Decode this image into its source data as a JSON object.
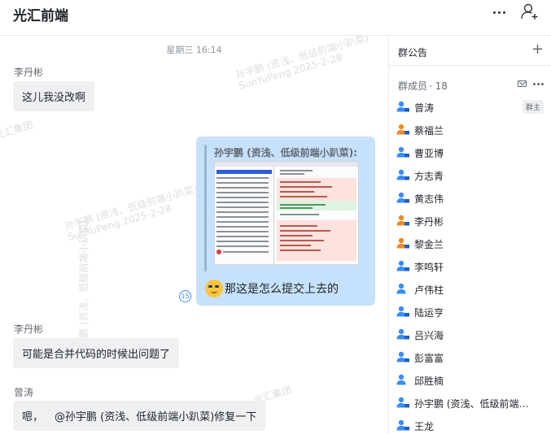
{
  "header": {
    "title": "光汇前端",
    "more_icon": "more-horizontal-icon",
    "add_member_icon": "user-add-icon"
  },
  "watermark": {
    "line1": "孙宇鹏 (资浅、低级前端小趴菜)",
    "line2": "SunYuPeng 2025-2-28",
    "company": "光汇集团"
  },
  "chat": {
    "timestamp": "星期三 16:14",
    "messages": [
      {
        "sender": "李丹彬",
        "text": "这儿我没改啊"
      },
      {
        "type": "reply-with-image",
        "quoted_author": "孙宇鹏 (资浅、低级前端小趴菜):",
        "reply_text": "那这是怎么提交上去的",
        "read_count": "15",
        "emoji_icon": "awkward-face-emoji-icon"
      },
      {
        "sender": "李丹彬",
        "text": "可能是合并代码的时候出问题了"
      },
      {
        "sender": "曾涛",
        "text_before": "嗯，",
        "mention": "@孙宇鹏 (资浅、低级前端小趴菜)",
        "text_after": " 修复一下"
      }
    ]
  },
  "sidebar": {
    "notice_label": "群公告",
    "notice_add_icon": "plus-icon",
    "members_label": "群成员",
    "members_count": "· 18",
    "mail_icon": "mail-icon",
    "more_icon": "more-horizontal-icon",
    "members": [
      {
        "name": "曾涛",
        "role": "群主",
        "avatar_color": "#3c8cf6",
        "accent_color": "#1f5fbf"
      },
      {
        "name": "蔡福兰",
        "role": "",
        "avatar_color": "#f08a24",
        "accent_color": "#1f5fbf"
      },
      {
        "name": "曹亚博",
        "role": "",
        "avatar_color": "#3c8cf6",
        "accent_color": "#1f5fbf"
      },
      {
        "name": "方志青",
        "role": "",
        "avatar_color": "#3c8cf6",
        "accent_color": "#1f5fbf"
      },
      {
        "name": "黄志伟",
        "role": "",
        "avatar_color": "#3c8cf6",
        "accent_color": "#1f5fbf"
      },
      {
        "name": "李丹彬",
        "role": "",
        "avatar_color": "#f08a24",
        "accent_color": "#1f5fbf"
      },
      {
        "name": "黎金兰",
        "role": "",
        "avatar_color": "#f08a24",
        "accent_color": "#1f5fbf"
      },
      {
        "name": "李鸣轩",
        "role": "",
        "avatar_color": "#3c8cf6",
        "accent_color": "#1f5fbf"
      },
      {
        "name": "卢伟柱",
        "role": "",
        "avatar_color": "#3c8cf6",
        "accent_color": ""
      },
      {
        "name": "陆运亨",
        "role": "",
        "avatar_color": "#3c8cf6",
        "accent_color": "#1f5fbf"
      },
      {
        "name": "吕兴海",
        "role": "",
        "avatar_color": "#3c8cf6",
        "accent_color": "#1f5fbf"
      },
      {
        "name": "彭富富",
        "role": "",
        "avatar_color": "#3c8cf6",
        "accent_color": "#1f5fbf"
      },
      {
        "name": "邱胜楠",
        "role": "",
        "avatar_color": "#3c8cf6",
        "accent_color": ""
      },
      {
        "name": "孙宇鹏 (资浅、低级前端…",
        "role": "",
        "avatar_color": "#3c8cf6",
        "accent_color": "#1f5fbf"
      },
      {
        "name": "王龙",
        "role": "",
        "avatar_color": "#3c8cf6",
        "accent_color": "#1f5fbf"
      }
    ]
  }
}
